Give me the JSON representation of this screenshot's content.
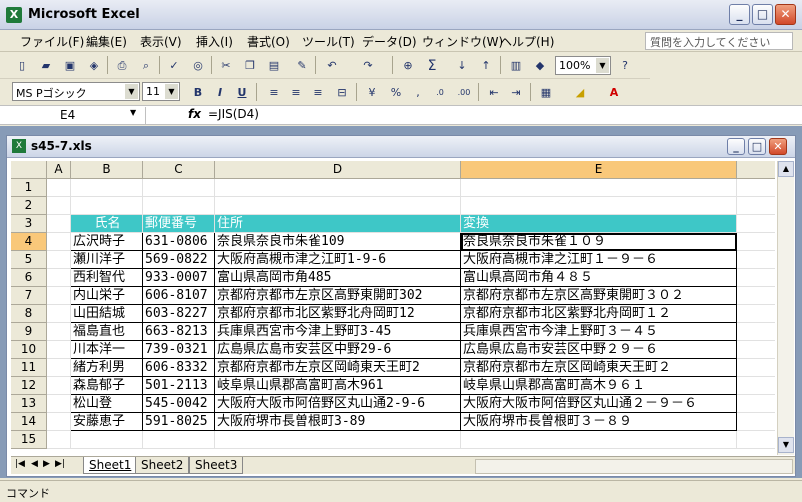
{
  "app": {
    "title": "Microsoft Excel",
    "icon": "excel-icon"
  },
  "menu": [
    "ファイル(F)",
    "編集(E)",
    "表示(V)",
    "挿入(I)",
    "書式(O)",
    "ツール(T)",
    "データ(D)",
    "ウィンドウ(W)",
    "ヘルプ(H)"
  ],
  "help_placeholder": "質問を入力してください",
  "toolbar": {
    "zoom": "100%",
    "font": "MS Pゴシック",
    "size": "11"
  },
  "formula_bar": {
    "cell": "E4",
    "formula": "=JIS(D4)"
  },
  "workbook": {
    "name": "s45-7.xls"
  },
  "columns": [
    "A",
    "B",
    "C",
    "D",
    "E"
  ],
  "rows": [
    "1",
    "2",
    "3",
    "4",
    "5",
    "6",
    "7",
    "8",
    "9",
    "10",
    "11",
    "12",
    "13",
    "14",
    "15"
  ],
  "table": {
    "headers": [
      "氏名",
      "郵便番号",
      "住所",
      "変換"
    ],
    "data": [
      [
        "広沢時子",
        "631-0806",
        "奈良県奈良市朱雀109",
        "奈良県奈良市朱雀１０９"
      ],
      [
        "瀬川洋子",
        "569-0822",
        "大阪府高槻市津之江町1-9-6",
        "大阪府高槻市津之江町１－９－６"
      ],
      [
        "西利智代",
        "933-0007",
        "富山県高岡市角485",
        "富山県高岡市角４８５"
      ],
      [
        "内山栄子",
        "606-8107",
        "京都府京都市左京区高野東開町302",
        "京都府京都市左京区高野東開町３０２"
      ],
      [
        "山田結城",
        "603-8227",
        "京都府京都市北区紫野北舟岡町12",
        "京都府京都市北区紫野北舟岡町１２"
      ],
      [
        "福島直也",
        "663-8213",
        "兵庫県西宮市今津上野町3-45",
        "兵庫県西宮市今津上野町３－４５"
      ],
      [
        "川本洋一",
        "739-0321",
        "広島県広島市安芸区中野29-6",
        "広島県広島市安芸区中野２９－６"
      ],
      [
        "緒方利男",
        "606-8332",
        "京都府京都市左京区岡崎東天王町2",
        "京都府京都市左京区岡崎東天王町２"
      ],
      [
        "森島郁子",
        "501-2113",
        "岐阜県山県郡高富町高木961",
        "岐阜県山県郡高富町高木９６１"
      ],
      [
        "松山登",
        "545-0042",
        "大阪府大阪市阿倍野区丸山通2-9-6",
        "大阪府大阪市阿倍野区丸山通２－９－６"
      ],
      [
        "安藤恵子",
        "591-8025",
        "大阪府堺市長曽根町3-89",
        "大阪府堺市長曽根町３－８９"
      ]
    ]
  },
  "sheets": [
    "Sheet1",
    "Sheet2",
    "Sheet3"
  ],
  "status": "コマンド",
  "colors": {
    "header_fill": "#3ec7c7",
    "selected_header": "#f9c87a"
  }
}
